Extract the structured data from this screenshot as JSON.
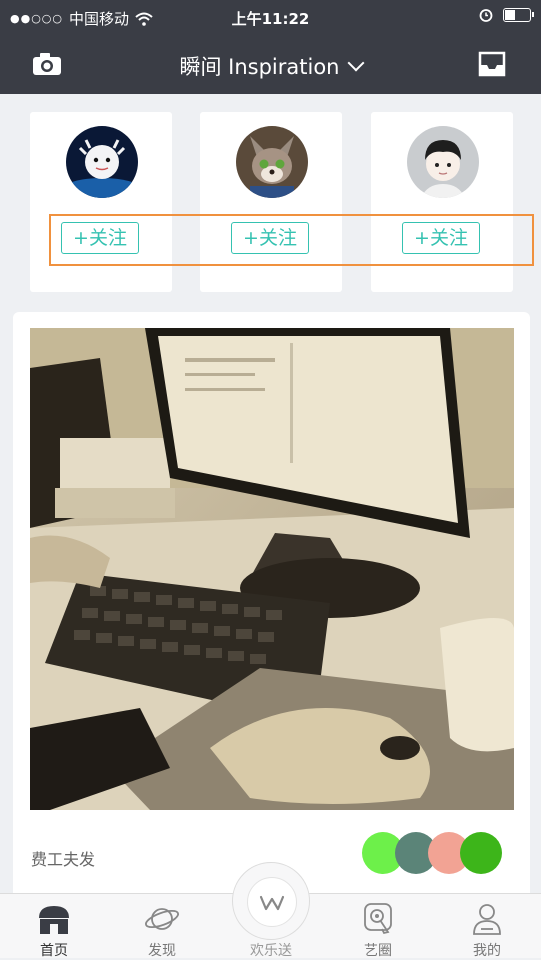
{
  "status": {
    "carrier": "中国移动",
    "time": "上午11:22",
    "signal_dots": "●●○○○"
  },
  "header": {
    "title": "瞬间 Inspiration"
  },
  "suggested_users": [
    {
      "follow_label": "+关注"
    },
    {
      "follow_label": "+关注"
    },
    {
      "follow_label": "+关注"
    }
  ],
  "post": {
    "author": "费工夫发",
    "colors": [
      "#6df04a",
      "#5b8478",
      "#f2a394",
      "#3db51a"
    ]
  },
  "tabs": [
    {
      "label": "首页",
      "icon": "home-icon",
      "active": true
    },
    {
      "label": "发现",
      "icon": "planet-icon",
      "active": false
    },
    {
      "label": "欢乐送",
      "icon": "w-logo-icon",
      "active": false
    },
    {
      "label": "艺圈",
      "icon": "circle-touch-icon",
      "active": false
    },
    {
      "label": "我的",
      "icon": "user-icon",
      "active": false
    }
  ],
  "accent_color": "#35c2b1",
  "highlight_color": "#f0913e"
}
